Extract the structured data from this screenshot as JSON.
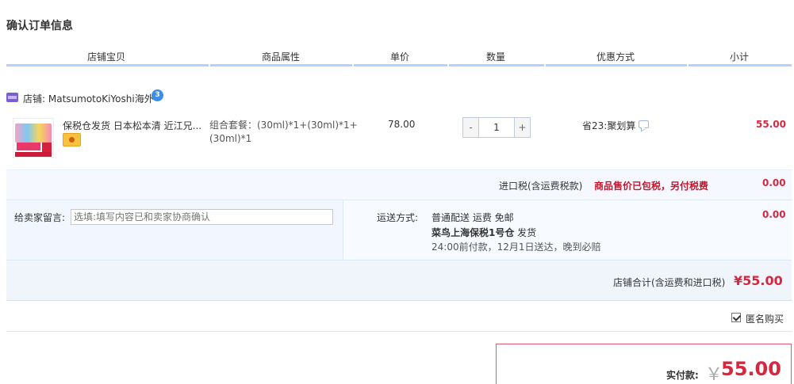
{
  "page": {
    "title": "确认订单信息"
  },
  "columns": {
    "item": "店铺宝贝",
    "attr": "商品属性",
    "price": "单价",
    "qty": "数量",
    "promo": "优惠方式",
    "subtotal": "小计"
  },
  "shop": {
    "label": "店铺:",
    "name": "MatsumotoKiYoshi海外",
    "chat_badge": "3"
  },
  "product": {
    "name": "保税仓发货 日本松本清 近江兄...",
    "attr": "组合套餐：(30ml)*1+(30ml)*1+(30ml)*1",
    "price": "78.00",
    "quantity": "1",
    "minus": "-",
    "plus": "+",
    "promo": "省23:聚划算",
    "subtotal": "55.00"
  },
  "tax": {
    "label": "进口税(含运费税款)",
    "note": "商品售价已包税，另付税费",
    "value": "0.00"
  },
  "message": {
    "label": "给卖家留言:",
    "placeholder": "选填:填写内容已和卖家协商确认"
  },
  "shipping": {
    "label": "运送方式:",
    "line1": "普通配送 运费 免邮",
    "warehouse": "菜鸟上海保税1号仓",
    "warehouse_suffix": " 发货",
    "line3": "24:00前付款，12月1日送达，晚到必赔",
    "value": "0.00"
  },
  "store_total": {
    "label": "店铺合计(含运费和进口税)",
    "value": "¥55.00"
  },
  "anonymous": {
    "label": "匿名购买",
    "checked": true
  },
  "payment": {
    "label": "实付款:",
    "currency": "￥",
    "value": "55.00"
  },
  "colors": {
    "accent_red": "#d9263f",
    "header_line": "#b2d1ff",
    "row_bg": "#f2f7ff"
  }
}
